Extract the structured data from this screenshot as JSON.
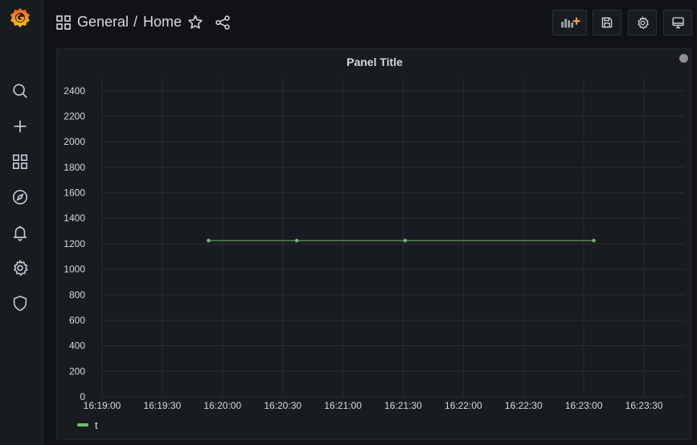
{
  "breadcrumb": {
    "folder": "General",
    "separator": "/",
    "dashboard": "Home"
  },
  "icons": {
    "logo": "grafana-logo-icon",
    "dashboard_grid": "apps-icon",
    "star": "star-icon",
    "share": "share-icon",
    "add_panel": "add-panel-icon",
    "save": "save-icon",
    "settings": "gear-icon",
    "view_mode": "monitor-icon",
    "sidebar": [
      "search-icon",
      "plus-icon",
      "apps-icon",
      "compass-icon",
      "bell-icon",
      "gear-icon",
      "shield-icon"
    ]
  },
  "colors": {
    "background": "#111217",
    "panel": "#181b1f",
    "series": "#73bf69",
    "add_panel_accent": "#f5a623",
    "logo_start": "#f05a28",
    "logo_end": "#fbca0a"
  },
  "panel": {
    "title": "Panel Title",
    "status": "grey"
  },
  "chart_data": {
    "type": "line",
    "title": "Panel Title",
    "x_ticks": [
      "16:19:00",
      "16:19:30",
      "16:20:00",
      "16:20:30",
      "16:21:00",
      "16:21:30",
      "16:22:00",
      "16:22:30",
      "16:23:00",
      "16:23:30"
    ],
    "y_ticks": [
      0,
      200,
      400,
      600,
      800,
      1000,
      1200,
      1400,
      1600,
      1800,
      2000,
      2200,
      2400
    ],
    "xlim": [
      "16:19:00",
      "16:23:50"
    ],
    "ylim": [
      0,
      2500
    ],
    "grid": true,
    "legend": "bottom-left",
    "series": [
      {
        "name": "t",
        "color": "#73bf69",
        "points": [
          {
            "x": "16:19:53",
            "y": 1225
          },
          {
            "x": "16:20:37",
            "y": 1225
          },
          {
            "x": "16:21:31",
            "y": 1225
          },
          {
            "x": "16:23:05",
            "y": 1225
          }
        ]
      }
    ]
  }
}
